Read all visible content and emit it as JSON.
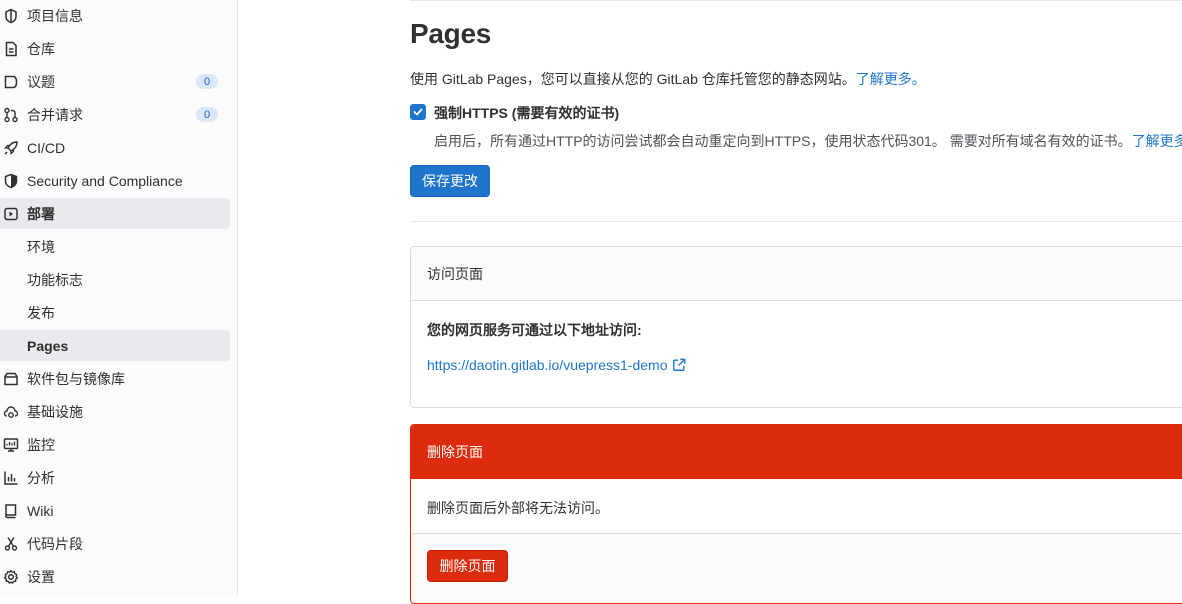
{
  "sidebar": {
    "items": [
      {
        "label": "项目信息",
        "icon": "project-icon"
      },
      {
        "label": "仓库",
        "icon": "doc-icon"
      },
      {
        "label": "议题",
        "icon": "issues-icon",
        "badge": "0"
      },
      {
        "label": "合并请求",
        "icon": "merge-request-icon",
        "badge": "0"
      },
      {
        "label": "CI/CD",
        "icon": "rocket-icon"
      },
      {
        "label": "Security and Compliance",
        "icon": "shield-icon"
      },
      {
        "label": "部署",
        "icon": "deployments-icon"
      },
      {
        "label": "环境"
      },
      {
        "label": "功能标志"
      },
      {
        "label": "发布"
      },
      {
        "label": "Pages"
      },
      {
        "label": "软件包与镜像库",
        "icon": "package-icon"
      },
      {
        "label": "基础设施",
        "icon": "cloud-gear-icon"
      },
      {
        "label": "监控",
        "icon": "monitor-icon"
      },
      {
        "label": "分析",
        "icon": "chart-icon"
      },
      {
        "label": "Wiki",
        "icon": "book-icon"
      },
      {
        "label": "代码片段",
        "icon": "snippet-icon"
      },
      {
        "label": "设置",
        "icon": "settings-icon"
      }
    ]
  },
  "main": {
    "title": "Pages",
    "intro_text": "使用 GitLab Pages，您可以直接从您的 GitLab 仓库托管您的静态网站。",
    "intro_link": "了解更多。",
    "force_https_label": "强制HTTPS (需要有效的证书)",
    "force_https_help": "启用后，所有通过HTTP的访问尝试都会自动重定向到HTTPS，使用状态代码301。 需要对所有域名有效的证书。",
    "force_https_help_link": "了解更多",
    "save_button": "保存更改",
    "access_card": {
      "header": "访问页面",
      "text": "您的网页服务可通过以下地址访问:",
      "url": "https://daotin.gitlab.io/vuepress1-demo"
    },
    "danger_card": {
      "header": "删除页面",
      "text": "删除页面后外部将无法访问。",
      "button": "删除页面"
    }
  },
  "colors": {
    "primary": "#1f75cb",
    "danger": "#dd2b0e",
    "sidebar_bg": "#fbfafd",
    "active_bg": "#e9e9ee"
  }
}
